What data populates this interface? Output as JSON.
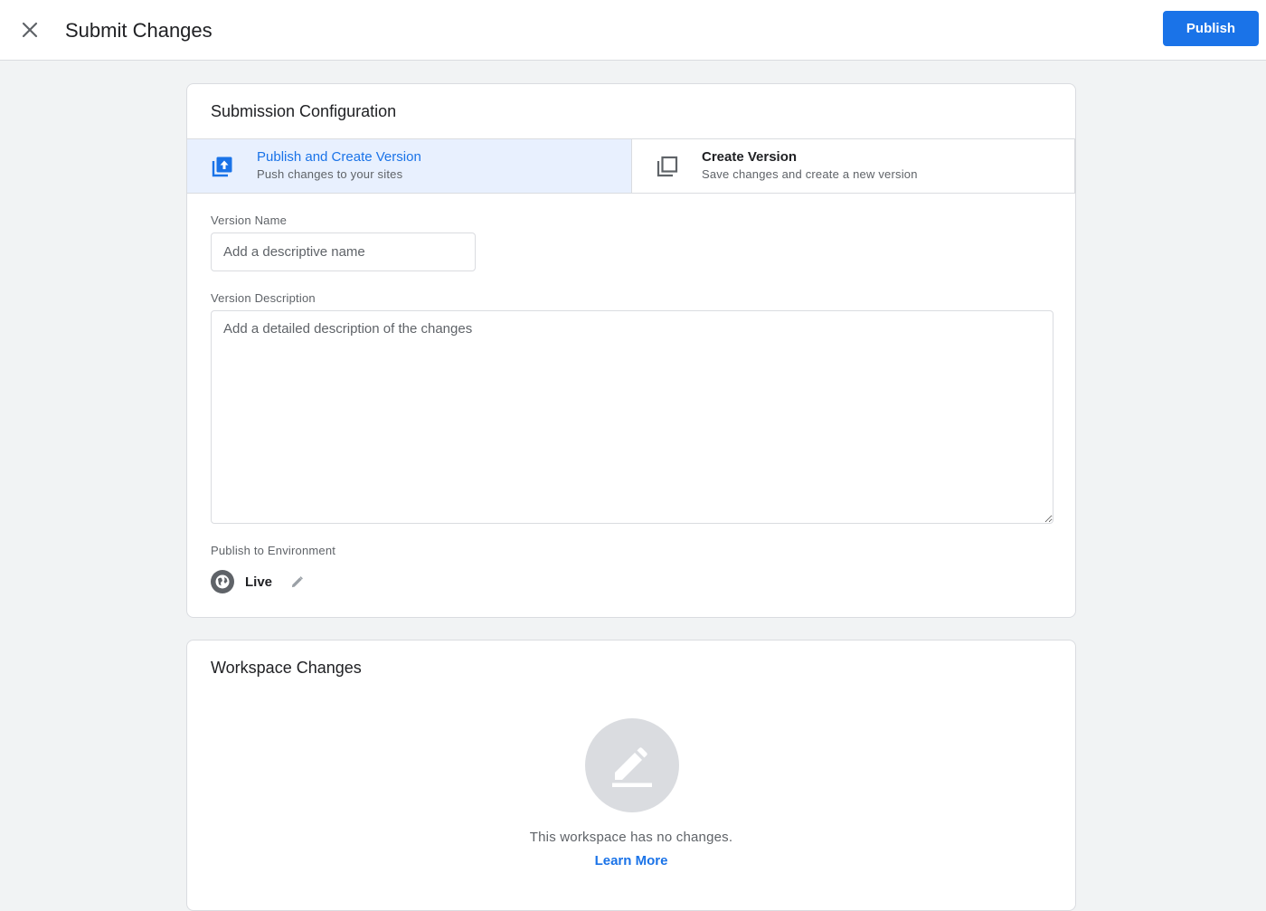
{
  "header": {
    "title": "Submit Changes",
    "publish_label": "Publish",
    "close_icon": "close-icon"
  },
  "config": {
    "title": "Submission Configuration",
    "options": [
      {
        "title": "Publish and Create Version",
        "subtitle": "Push changes to your sites",
        "icon": "publish-upload-icon",
        "selected": true
      },
      {
        "title": "Create Version",
        "subtitle": "Save changes and create a new version",
        "icon": "copy-version-icon",
        "selected": false
      }
    ],
    "version_name": {
      "label": "Version Name",
      "value": "",
      "placeholder": "Add a descriptive name"
    },
    "version_description": {
      "label": "Version Description",
      "value": "",
      "placeholder": "Add a detailed description of the changes"
    },
    "environment": {
      "label": "Publish to Environment",
      "name": "Live",
      "icon": "globe-icon",
      "edit_icon": "pencil-icon"
    }
  },
  "workspace": {
    "title": "Workspace Changes",
    "empty_icon": "edit-icon",
    "empty_text": "This workspace has no changes.",
    "learn_more": "Learn More"
  },
  "colors": {
    "accent": "#1a73e8",
    "selected_bg": "#e8f0fe",
    "page_bg": "#f1f3f4",
    "border": "#dadce0"
  }
}
